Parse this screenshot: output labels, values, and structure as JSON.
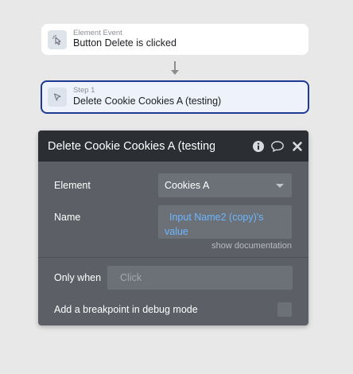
{
  "event_card": {
    "subtitle": "Element Event",
    "title": "Button Delete is clicked",
    "icon": "cursor-click-icon"
  },
  "step_card": {
    "subtitle": "Step 1",
    "title": "Delete Cookie Cookies A (testing)",
    "icon": "pointer-icon"
  },
  "panel": {
    "title": "Delete Cookie Cookies A (testing",
    "element_label": "Element",
    "element_value": "Cookies A",
    "name_label": "Name",
    "name_value": "Input Name2 (copy)'s value",
    "doc_link": "show documentation",
    "only_when_label": "Only when",
    "only_when_placeholder": "Click",
    "breakpoint_label": "Add a breakpoint in debug mode",
    "breakpoint_checked": false
  },
  "colors": {
    "background": "#e8e8e8",
    "step_border": "#1f3a93",
    "panel_bg": "#5c6066",
    "panel_header": "#2b2f33",
    "dynamic_text": "#6cb6ff"
  }
}
